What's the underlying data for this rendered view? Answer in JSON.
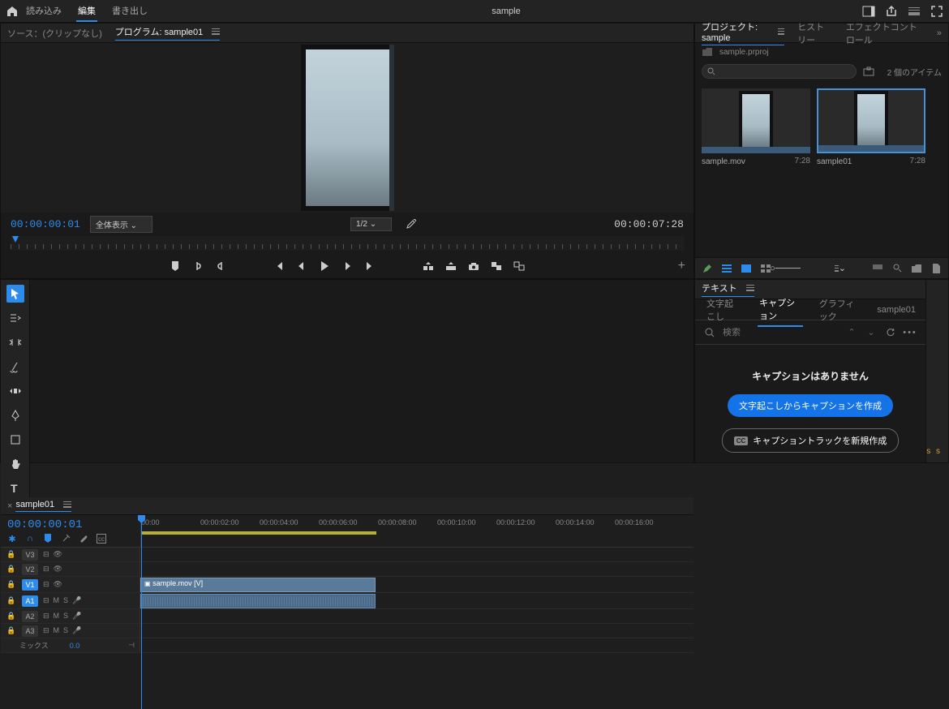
{
  "topbar": {
    "tab_import": "読み込み",
    "tab_edit": "編集",
    "tab_export": "書き出し",
    "title": "sample"
  },
  "program": {
    "tab_source": "ソース：(クリップなし)",
    "tab_program": "プログラム: sample01",
    "tc_current": "00:00:00:01",
    "fit_label": "全体表示",
    "scale_label": "1/2",
    "tc_duration": "00:00:07:28"
  },
  "project": {
    "tab_project": "プロジェクト: sample",
    "tab_history": "ヒストリー",
    "tab_effect": "エフェクトコントロール",
    "filename": "sample.prproj",
    "item_count": "2 個のアイテム",
    "items": [
      {
        "name": "sample.mov",
        "dur": "7:28"
      },
      {
        "name": "sample01",
        "dur": "7:28"
      }
    ]
  },
  "timeline": {
    "tab": "sample01",
    "tc": "00:00:00:01",
    "ticks": [
      "00:00",
      "00:00:02:00",
      "00:00:04:00",
      "00:00:06:00",
      "00:00:08:00",
      "00:00:10:00",
      "00:00:12:00",
      "00:00:14:00",
      "00:00:16:00"
    ],
    "tracks": {
      "v3": "V3",
      "v2": "V2",
      "v1": "V1",
      "a1": "A1",
      "a2": "A2",
      "a3": "A3",
      "mix": "ミックス",
      "mix_val": "0.0",
      "m": "M",
      "s": "S"
    },
    "clip_name": "sample.mov [V]"
  },
  "text": {
    "tab_label": "テキスト",
    "subtab_transcribe": "文字起こし",
    "subtab_caption": "キャプション",
    "subtab_graphic": "グラフィック",
    "sequence": "sample01",
    "search_placeholder": "検索",
    "empty": "キャプションはありません",
    "btn_create_from": "文字起こしからキャプションを作成",
    "btn_new_track": "キャプショントラックを新規作成",
    "cc": "CC"
  },
  "rail": {
    "ss": "s s"
  }
}
